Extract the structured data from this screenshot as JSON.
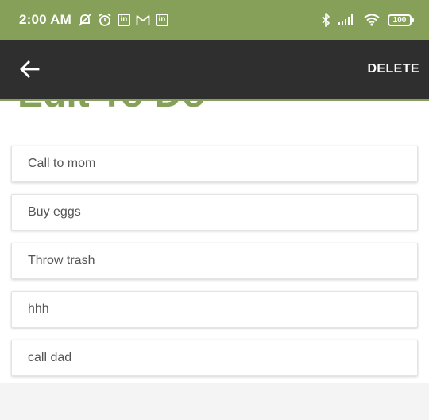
{
  "status_bar": {
    "time": "2:00 AM",
    "left_icons": [
      "muted-alarm-icon",
      "alarm-icon",
      "linkedin-icon",
      "gmail-icon",
      "linkedin-icon"
    ],
    "battery": "100",
    "right_icons": [
      "bluetooth-icon",
      "cellular-signal-icon",
      "wifi-icon",
      "battery-icon"
    ]
  },
  "app_bar": {
    "back_icon": "arrow-left-icon",
    "delete_label": "DELETE"
  },
  "header": {
    "title_partial": "Edit To Do"
  },
  "list": {
    "items": [
      "Call to mom",
      "Buy eggs",
      "Throw trash",
      "hhh",
      "call dad"
    ]
  },
  "colors": {
    "accent": "#86a05a",
    "app_bar": "#2f2f2f",
    "background": "#f4f4f4"
  }
}
